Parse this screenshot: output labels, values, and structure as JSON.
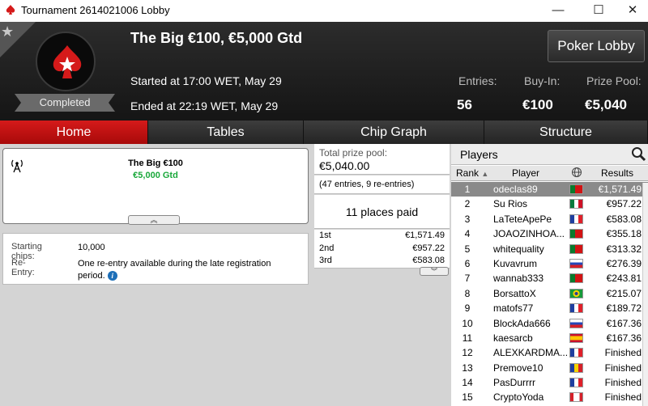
{
  "window": {
    "title": "Tournament 2614021006 Lobby",
    "minimize": "—",
    "maximize": "☐",
    "close": "✕"
  },
  "header": {
    "title": "The Big €100, €5,000 Gtd",
    "started": "Started at 17:00 WET, May 29",
    "ended": "Ended at 22:19 WET, May 29",
    "status": "Completed",
    "poker_lobby": "Poker Lobby",
    "entries_label": "Entries:",
    "entries_value": "56",
    "buyin_label": "Buy-In:",
    "buyin_value": "€100",
    "prize_label": "Prize Pool:",
    "prize_value": "€5,040"
  },
  "tabs": [
    {
      "label": "Home",
      "active": true
    },
    {
      "label": "Tables"
    },
    {
      "label": "Chip Graph"
    },
    {
      "label": "Structure"
    }
  ],
  "home": {
    "name_line1": "The Big €100",
    "name_line2": "€5,000 Gtd",
    "starting_chips_label": "Starting chips:",
    "starting_chips_value": "10,000",
    "reentry_label": "Re-Entry:",
    "reentry_value": "One re-entry available during the late registration period."
  },
  "prize": {
    "total_label": "Total prize pool:",
    "total_value": "€5,040.00",
    "entries_text": "(47 entries, 9 re-entries)",
    "places_paid": "11 places paid",
    "payouts": [
      {
        "place": "1st",
        "amount": "€1,571.49"
      },
      {
        "place": "2nd",
        "amount": "€957.22"
      },
      {
        "place": "3rd",
        "amount": "€583.08"
      }
    ]
  },
  "players": {
    "heading": "Players",
    "col_rank": "Rank",
    "col_player": "Player",
    "col_results": "Results",
    "rows": [
      {
        "rank": "1",
        "name": "odeclas89",
        "flag": "portugal",
        "result": "€1,571.49"
      },
      {
        "rank": "2",
        "name": "Su Rios",
        "flag": "mexico",
        "result": "€957.22"
      },
      {
        "rank": "3",
        "name": "LaTeteApePe",
        "flag": "france",
        "result": "€583.08"
      },
      {
        "rank": "4",
        "name": "JOAOZINHOA...",
        "flag": "portugal",
        "result": "€355.18"
      },
      {
        "rank": "5",
        "name": "whitequality",
        "flag": "portugal",
        "result": "€313.32"
      },
      {
        "rank": "6",
        "name": "Kuvavrum",
        "flag": "russia",
        "result": "€276.39"
      },
      {
        "rank": "7",
        "name": "wannab333",
        "flag": "portugal",
        "result": "€243.81"
      },
      {
        "rank": "8",
        "name": "BorsattoX",
        "flag": "brazil",
        "result": "€215.07"
      },
      {
        "rank": "9",
        "name": "matofs77",
        "flag": "france",
        "result": "€189.72"
      },
      {
        "rank": "10",
        "name": "BlockAda666",
        "flag": "russia",
        "result": "€167.36"
      },
      {
        "rank": "11",
        "name": "kaesarcb",
        "flag": "spain",
        "result": "€167.36"
      },
      {
        "rank": "12",
        "name": "ALEXKARDMA...",
        "flag": "france",
        "result": "Finished"
      },
      {
        "rank": "13",
        "name": "Premove10",
        "flag": "moldova",
        "result": "Finished"
      },
      {
        "rank": "14",
        "name": "PasDurrrr",
        "flag": "france",
        "result": "Finished"
      },
      {
        "rank": "15",
        "name": "CryptoYoda",
        "flag": "canada",
        "result": "Finished"
      }
    ]
  },
  "colors": {
    "accent_red": "#d51a1a",
    "finished_green": "#19a83a"
  }
}
